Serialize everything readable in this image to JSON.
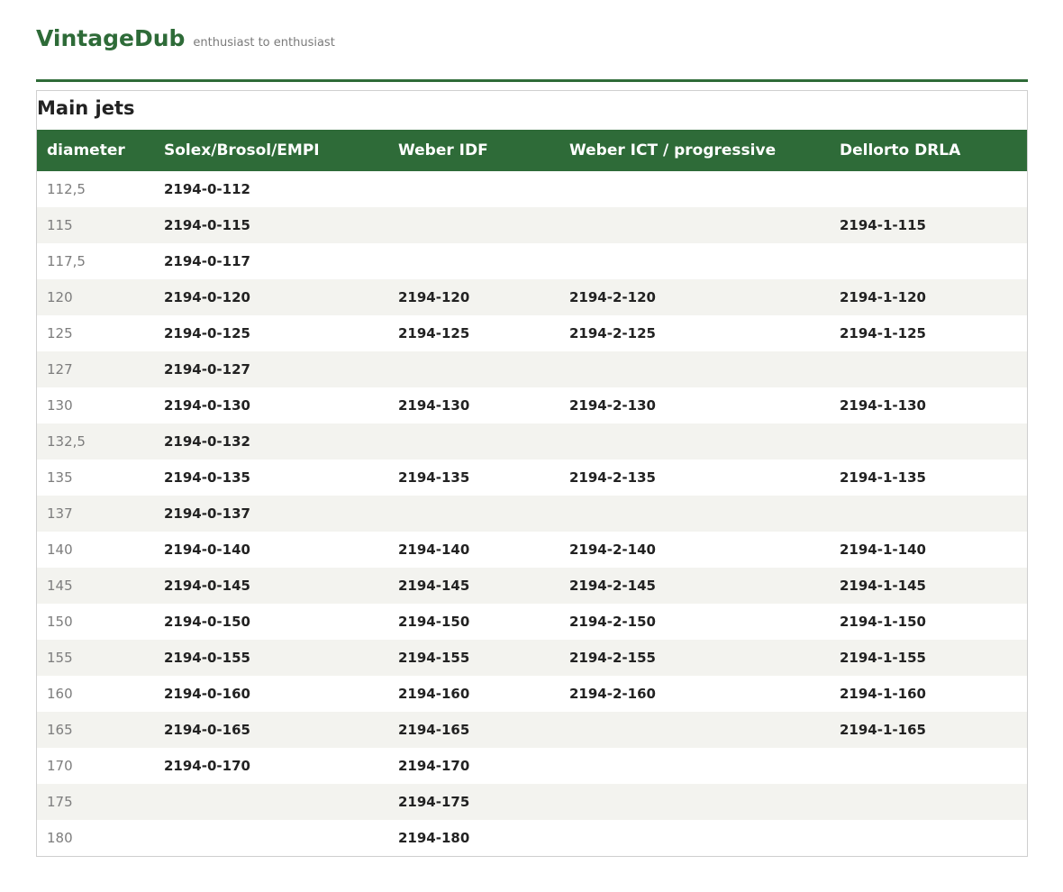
{
  "site": {
    "brand": "VintageDub",
    "tagline": "enthusiast to enthusiast"
  },
  "colors": {
    "accent": "#2e6b38",
    "row_alt": "#f3f3ef",
    "muted_text": "#7d7d7d"
  },
  "section": {
    "title": "Main jets"
  },
  "table": {
    "columns": [
      "diameter",
      "Solex/Brosol/EMPI",
      "Weber IDF",
      "Weber ICT / progressive",
      "Dellorto DRLA"
    ],
    "rows": [
      [
        "112,5",
        "2194-0-112",
        "",
        "",
        ""
      ],
      [
        "115",
        "2194-0-115",
        "",
        "",
        "2194-1-115"
      ],
      [
        "117,5",
        "2194-0-117",
        "",
        "",
        ""
      ],
      [
        "120",
        "2194-0-120",
        "2194-120",
        "2194-2-120",
        "2194-1-120"
      ],
      [
        "125",
        "2194-0-125",
        "2194-125",
        "2194-2-125",
        "2194-1-125"
      ],
      [
        "127",
        "2194-0-127",
        "",
        "",
        ""
      ],
      [
        "130",
        "2194-0-130",
        "2194-130",
        "2194-2-130",
        "2194-1-130"
      ],
      [
        "132,5",
        "2194-0-132",
        "",
        "",
        ""
      ],
      [
        "135",
        "2194-0-135",
        "2194-135",
        "2194-2-135",
        "2194-1-135"
      ],
      [
        "137",
        "2194-0-137",
        "",
        "",
        ""
      ],
      [
        "140",
        "2194-0-140",
        "2194-140",
        "2194-2-140",
        "2194-1-140"
      ],
      [
        "145",
        "2194-0-145",
        "2194-145",
        "2194-2-145",
        "2194-1-145"
      ],
      [
        "150",
        "2194-0-150",
        "2194-150",
        "2194-2-150",
        "2194-1-150"
      ],
      [
        "155",
        "2194-0-155",
        "2194-155",
        "2194-2-155",
        "2194-1-155"
      ],
      [
        "160",
        "2194-0-160",
        "2194-160",
        "2194-2-160",
        "2194-1-160"
      ],
      [
        "165",
        "2194-0-165",
        "2194-165",
        "",
        "2194-1-165"
      ],
      [
        "170",
        "2194-0-170",
        "2194-170",
        "",
        ""
      ],
      [
        "175",
        "",
        "2194-175",
        "",
        ""
      ],
      [
        "180",
        "",
        "2194-180",
        "",
        ""
      ]
    ]
  }
}
